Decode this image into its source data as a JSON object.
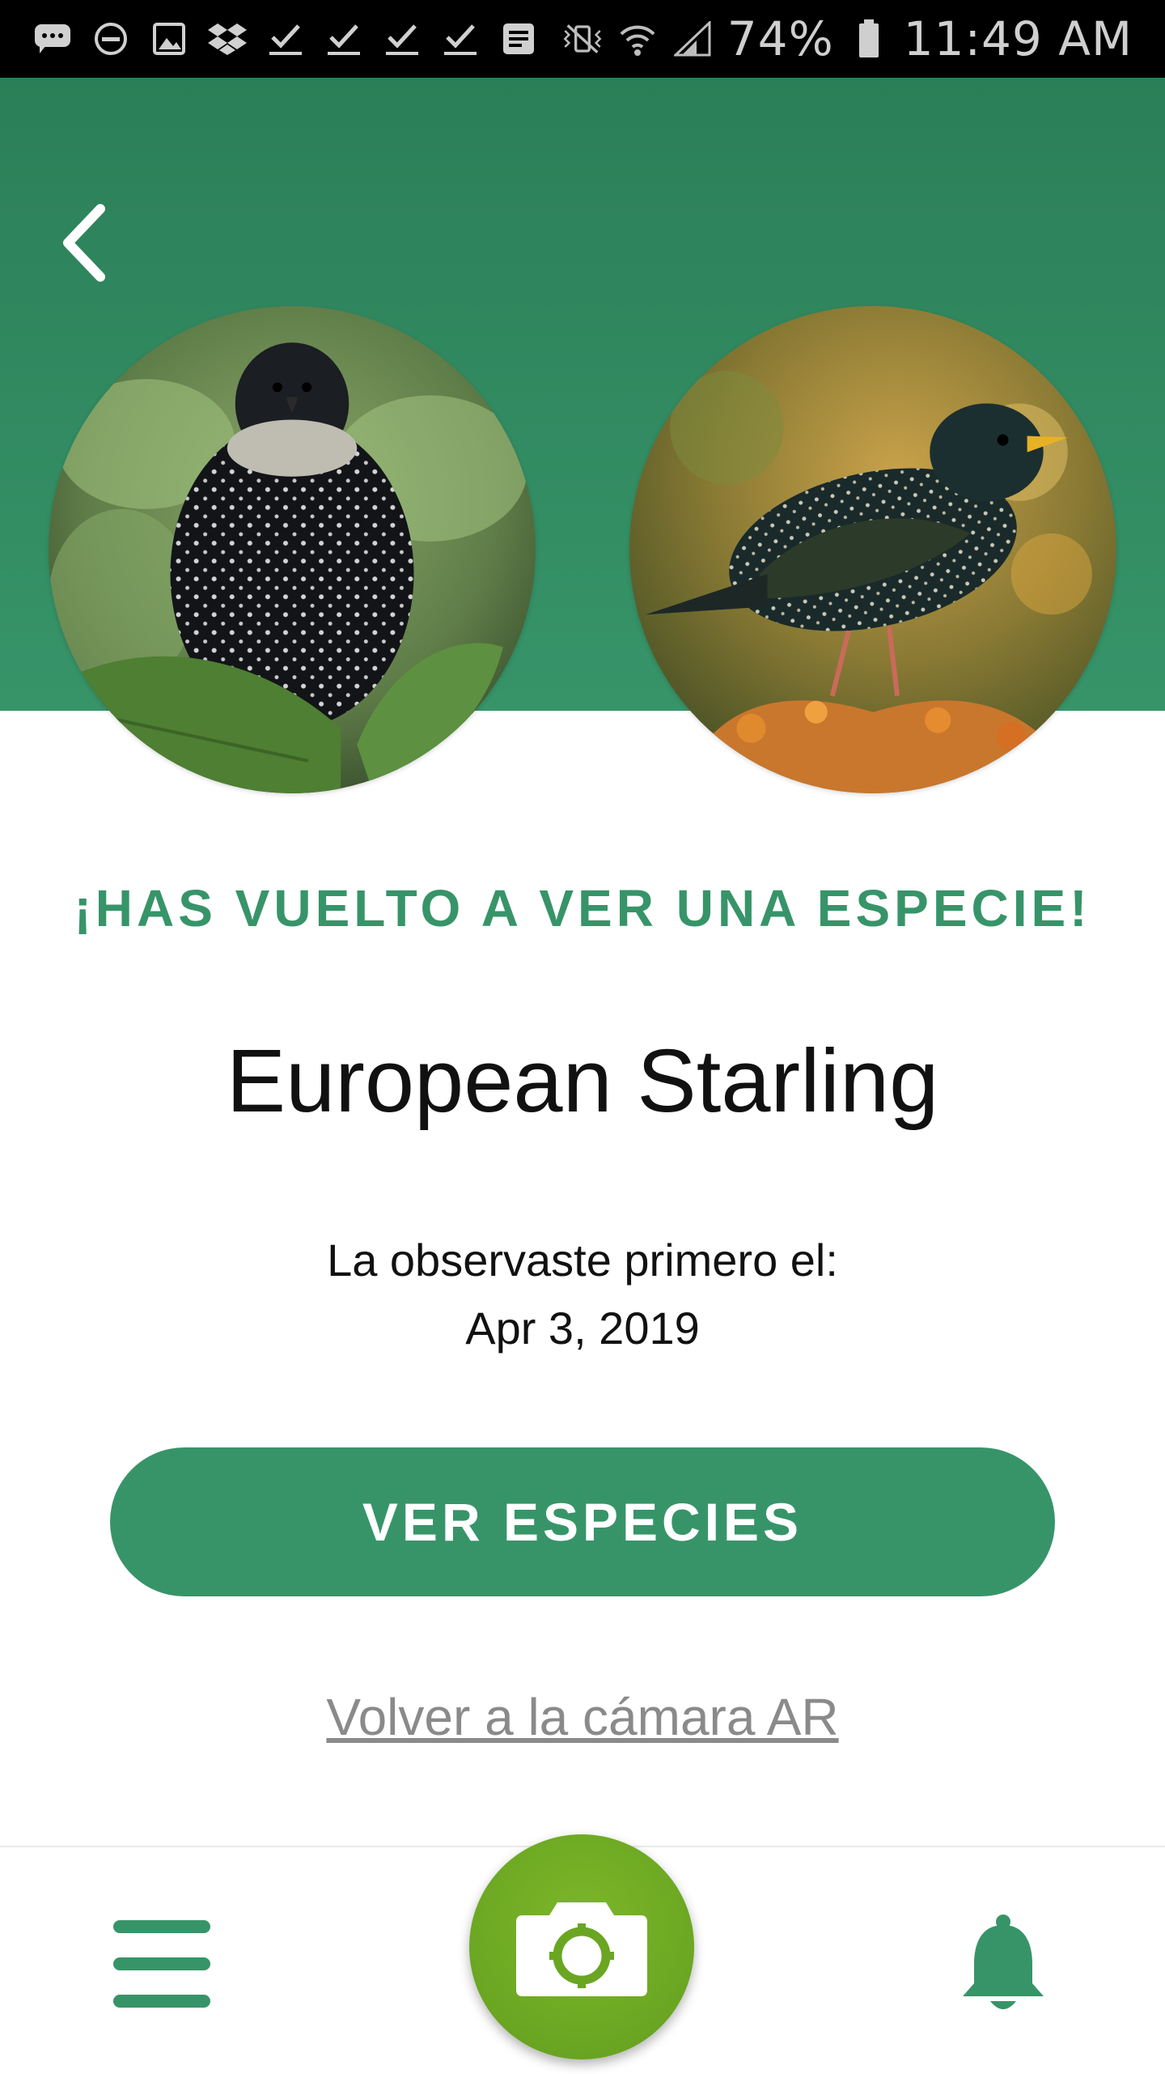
{
  "status_bar": {
    "battery": "74%",
    "time": "11:49 AM",
    "icons": [
      "messages-icon",
      "do-not-disturb-icon",
      "gallery-icon",
      "dropbox-icon",
      "check-icon",
      "check-icon",
      "check-icon",
      "check-icon",
      "notes-icon",
      "vibrate-icon",
      "wifi-icon",
      "signal-icon",
      "battery-icon"
    ]
  },
  "header": {
    "back_icon": "chevron-left-icon",
    "photos": [
      "starling-front-photo",
      "starling-side-photo"
    ]
  },
  "content": {
    "headline": "¡HAS VUELTO A VER UNA ESPECIE!",
    "species_name": "European Starling",
    "first_seen_label": "La observaste primero el:",
    "first_seen_date": "Apr 3, 2019",
    "cta_label": "VER ESPECIES",
    "back_link": "Volver a la cámara AR"
  },
  "bottom_nav": {
    "menu_icon": "hamburger-menu-icon",
    "camera_icon": "camera-icon",
    "notifications_icon": "bell-icon"
  },
  "colors": {
    "primary_green": "#379469",
    "header_dark_green": "#2b7f58",
    "camera_green": "#6aa622"
  }
}
